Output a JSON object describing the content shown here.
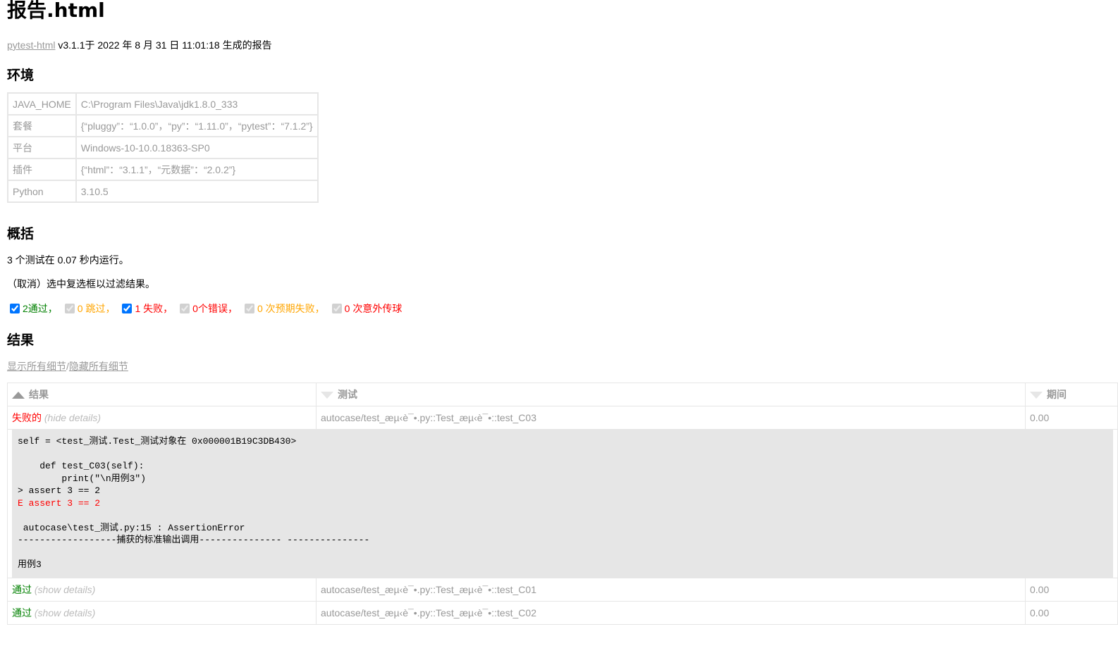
{
  "title": "报告.html",
  "generated": {
    "link": "pytest-html",
    "text": " v3.1.1于 2022 年 8 月 31 日 11:01:18 生成的报告"
  },
  "environment": {
    "heading": "环境",
    "rows": [
      {
        "key": "JAVA_HOME",
        "value": "C:\\Program Files\\Java\\jdk1.8.0_333"
      },
      {
        "key": "套餐",
        "value": "{“pluggy”：“1.0.0”，“py”：“1.11.0”，“pytest”：“7.1.2”}"
      },
      {
        "key": "平台",
        "value": "Windows-10-10.0.18363-SP0"
      },
      {
        "key": "插件",
        "value": "{“html”：“3.1.1”，“元数据”：“2.0.2”}"
      },
      {
        "key": "Python",
        "value": "3.10.5"
      }
    ]
  },
  "summary": {
    "heading": "概括",
    "run_text": "3 个测试在 0.07 秒内运行。",
    "filter_hint": "（取消）选中复选框以过滤结果。",
    "filters": [
      {
        "label": "2通过，",
        "class": "passed",
        "checked": true,
        "disabled": false
      },
      {
        "label": "0 跳过，",
        "class": "skipped",
        "checked": true,
        "disabled": true
      },
      {
        "label": "1 失败，",
        "class": "failed",
        "checked": true,
        "disabled": false
      },
      {
        "label": "0个错误，",
        "class": "error",
        "checked": true,
        "disabled": true
      },
      {
        "label": "0 次预期失败，",
        "class": "xfailed",
        "checked": true,
        "disabled": true
      },
      {
        "label": "0 次意外传球",
        "class": "xpassed",
        "checked": true,
        "disabled": true
      }
    ]
  },
  "results": {
    "heading": "结果",
    "show_all": "显示所有细节",
    "separator": "/",
    "hide_all": "隐藏所有细节",
    "columns": [
      "结果",
      "测试",
      "期间"
    ],
    "rows": [
      {
        "result": "失败的",
        "result_class": "failed",
        "details": "(hide details)",
        "test": "autocase/test_æµ‹è¯•.py::Test_æµ‹è¯•::test_C03",
        "duration": "0.00",
        "log": [
          {
            "text": "self = <test_测试.Test_测试对象在 0x000001B19C3DB430>",
            "err": false
          },
          {
            "text": "",
            "err": false
          },
          {
            "text": "    def test_C03(self):",
            "err": false
          },
          {
            "text": "        print(\"\\n用例3\")",
            "err": false
          },
          {
            "text": "> assert 3 == 2",
            "err": false
          },
          {
            "text": "E assert 3 == 2",
            "err": true
          },
          {
            "text": "",
            "err": false
          },
          {
            "text": " autocase\\test_测试.py:15 : AssertionError",
            "err": false
          },
          {
            "text": "------------------捕获的标准输出调用--------------- ---------------",
            "err": false
          },
          {
            "text": "",
            "err": false
          },
          {
            "text": "用例3",
            "err": false
          }
        ]
      },
      {
        "result": "通过",
        "result_class": "passed",
        "details": "(show details)",
        "test": "autocase/test_æµ‹è¯•.py::Test_æµ‹è¯•::test_C01",
        "duration": "0.00"
      },
      {
        "result": "通过",
        "result_class": "passed",
        "details": "(show details)",
        "test": "autocase/test_æµ‹è¯•.py::Test_æµ‹è¯•::test_C02",
        "duration": "0.00"
      }
    ]
  }
}
